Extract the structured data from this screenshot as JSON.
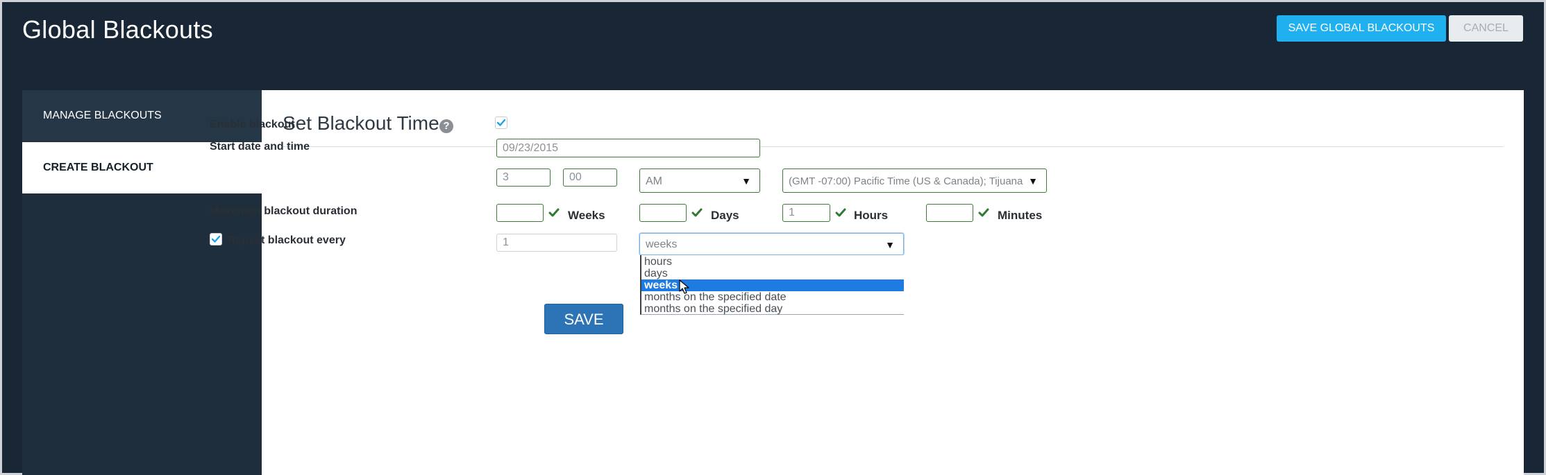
{
  "header": {
    "title": "Global Blackouts",
    "save_button": "SAVE GLOBAL BLACKOUTS",
    "cancel_button": "CANCEL"
  },
  "sidebar": {
    "items": [
      {
        "label": "MANAGE BLACKOUTS",
        "active": false
      },
      {
        "label": "CREATE BLACKOUT",
        "active": true
      }
    ]
  },
  "form": {
    "section_title": "Set Blackout Time",
    "help_icon": "?",
    "enable_label": "Enable blackout",
    "enable_checked": true,
    "start_label": "Start date and time",
    "start_date": "09/23/2015",
    "hour": "3",
    "minute": "00",
    "ampm": "AM",
    "timezone": "(GMT -07:00) Pacific Time (US & Canada); Tijuana",
    "duration_label": "Maximum blackout duration",
    "duration": {
      "weeks_value": "",
      "weeks_label": "Weeks",
      "days_value": "",
      "days_label": "Days",
      "hours_value": "1",
      "hours_label": "Hours",
      "minutes_value": "",
      "minutes_label": "Minutes"
    },
    "repeat_label": "Repeat blackout every",
    "repeat_checked": true,
    "repeat_value": "1",
    "repeat_unit": "weeks",
    "repeat_options": [
      "hours",
      "days",
      "weeks",
      "months on the specified date",
      "months on the specified day"
    ],
    "save_button": "SAVE"
  },
  "colors": {
    "background": "#182635",
    "accent": "#1fb0f0",
    "valid_green": "#3c7a35",
    "save_blue": "#2c74b5",
    "selection_blue": "#1e7be2"
  }
}
